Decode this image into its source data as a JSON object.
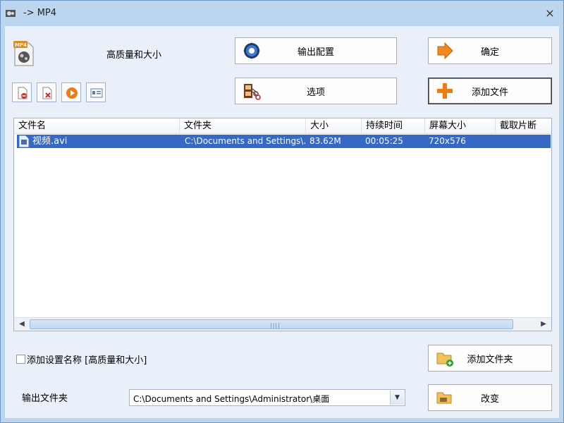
{
  "window": {
    "title": "-> MP4",
    "close_symbol": "×"
  },
  "profile": {
    "label": "高质量和大小"
  },
  "buttons": {
    "output_config": "输出配置",
    "options": "选项",
    "confirm": "确定",
    "add_file": "添加文件",
    "add_folder": "添加文件夹",
    "change": "改变"
  },
  "toolbar": {
    "icons": [
      "clear-list-icon",
      "remove-file-icon",
      "play-icon",
      "media-info-icon"
    ]
  },
  "file_list": {
    "columns": [
      "文件名",
      "文件夹",
      "大小",
      "持续时间",
      "屏幕大小",
      "截取片断"
    ],
    "rows": [
      {
        "name": "视频.avi",
        "folder": "C:\\Documents and Settings\\...",
        "size": "83.62M",
        "duration": "00:05:25",
        "screen": "720x576",
        "clip": ""
      }
    ],
    "selected_row": 0
  },
  "append_setting": {
    "label": "添加设置名称 [高质量和大小]",
    "checked": false
  },
  "output_folder": {
    "label": "输出文件夹",
    "value": "C:\\Documents and Settings\\Administrator\\桌面"
  },
  "colors": {
    "selection": "#3669c4",
    "client_bg": "#e9f0fa",
    "frame": "#bcd6f0"
  }
}
